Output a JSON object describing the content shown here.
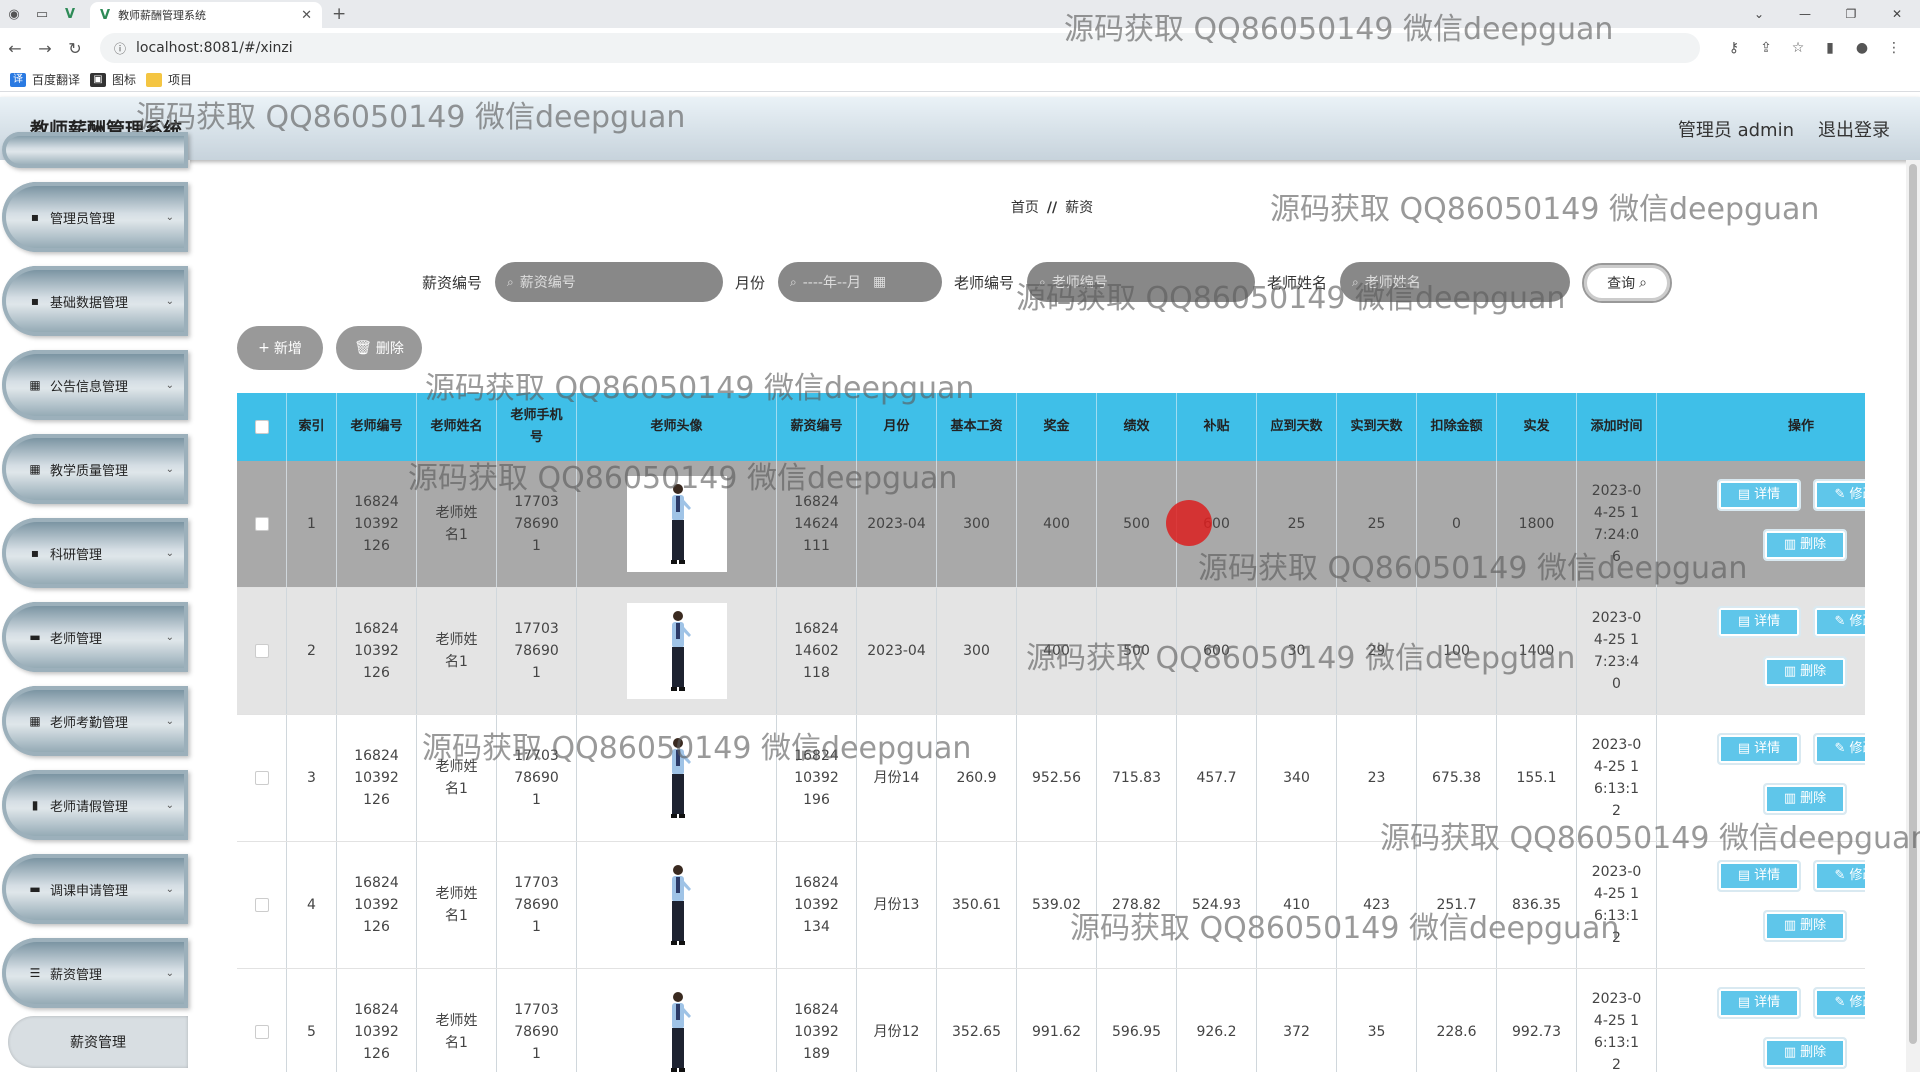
{
  "browser": {
    "tab_title": "教师薪酬管理系统",
    "url": "localhost:8081/#/xinzi",
    "bookmarks": [
      "百度翻译",
      "图标",
      "项目"
    ]
  },
  "header": {
    "title": "教师薪酬管理系统",
    "user": "管理员 admin",
    "logout": "退出登录"
  },
  "sidebar": {
    "items": [
      {
        "label": "管理员管理",
        "icon": "briefcase-icon"
      },
      {
        "label": "基础数据管理",
        "icon": "clipboard-icon"
      },
      {
        "label": "公告信息管理",
        "icon": "grid-icon"
      },
      {
        "label": "教学质量管理",
        "icon": "grid-icon"
      },
      {
        "label": "科研管理",
        "icon": "clipboard-icon"
      },
      {
        "label": "老师管理",
        "icon": "monitor-icon"
      },
      {
        "label": "老师考勤管理",
        "icon": "grid-icon"
      },
      {
        "label": "老师请假管理",
        "icon": "chart-icon"
      },
      {
        "label": "调课申请管理",
        "icon": "monitor-icon"
      },
      {
        "label": "薪资管理",
        "icon": "sliders-icon"
      }
    ],
    "active_sub": "薪资管理"
  },
  "breadcrumb": {
    "home": "首页",
    "sep": "//",
    "current": "薪资"
  },
  "search": {
    "f1_label": "薪资编号",
    "f1_placeholder": "薪资编号",
    "f2_label": "月份",
    "f2_placeholder": "----年--月",
    "f3_label": "老师编号",
    "f3_placeholder": "老师编号",
    "f4_label": "老师姓名",
    "f4_placeholder": "老师姓名",
    "query": "查询"
  },
  "actions": {
    "add": "新增",
    "delete": "删除"
  },
  "table": {
    "headers": [
      "索引",
      "老师编号",
      "老师姓名",
      "老师手机号",
      "老师头像",
      "薪资编号",
      "月份",
      "基本工资",
      "奖金",
      "绩效",
      "补贴",
      "应到天数",
      "实到天数",
      "扣除金额",
      "实发",
      "添加时间",
      "操作"
    ],
    "row_buttons": {
      "detail": "详情",
      "edit": "修改",
      "delete": "删除"
    },
    "rows": [
      {
        "idx": "1",
        "tno": "1682410392126",
        "tname": "老师姓名1",
        "phone": "17703786901",
        "sno": "1682414624111",
        "month": "2023-04",
        "base": "300",
        "bonus": "400",
        "perf": "500",
        "allow": "600",
        "due": "25",
        "actual": "25",
        "deduct": "0",
        "net": "1800",
        "time": "2023-04-25 17:24:06"
      },
      {
        "idx": "2",
        "tno": "1682410392126",
        "tname": "老师姓名1",
        "phone": "17703786901",
        "sno": "1682414602118",
        "month": "2023-04",
        "base": "300",
        "bonus": "400",
        "perf": "500",
        "allow": "600",
        "due": "30",
        "actual": "29",
        "deduct": "100",
        "net": "1400",
        "time": "2023-04-25 17:23:40"
      },
      {
        "idx": "3",
        "tno": "1682410392126",
        "tname": "老师姓名1",
        "phone": "17703786901",
        "sno": "1682410392196",
        "month": "月份14",
        "base": "260.9",
        "bonus": "952.56",
        "perf": "715.83",
        "allow": "457.7",
        "due": "340",
        "actual": "23",
        "deduct": "675.38",
        "net": "155.1",
        "time": "2023-04-25 16:13:12"
      },
      {
        "idx": "4",
        "tno": "1682410392126",
        "tname": "老师姓名1",
        "phone": "17703786901",
        "sno": "1682410392134",
        "month": "月份13",
        "base": "350.61",
        "bonus": "539.02",
        "perf": "278.82",
        "allow": "524.93",
        "due": "410",
        "actual": "423",
        "deduct": "251.7",
        "net": "836.35",
        "time": "2023-04-25 16:13:12"
      },
      {
        "idx": "5",
        "tno": "1682410392126",
        "tname": "老师姓名1",
        "phone": "17703786901",
        "sno": "1682410392189",
        "month": "月份12",
        "base": "352.65",
        "bonus": "991.62",
        "perf": "596.95",
        "allow": "926.2",
        "due": "372",
        "actual": "35",
        "deduct": "228.6",
        "net": "992.73",
        "time": "2023-04-25 16:13:12"
      }
    ]
  },
  "watermark": "源码获取 QQ86050149 微信deepguan",
  "colors": {
    "table_header": "#3fbfe8",
    "button": "#5fc6ea",
    "row_hover": "#a9a9a9",
    "row_alt": "#e4e4e4"
  }
}
